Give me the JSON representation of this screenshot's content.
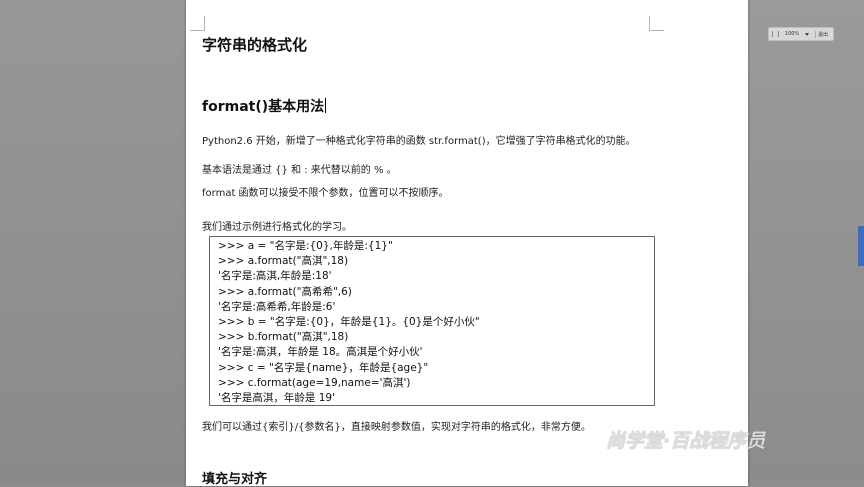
{
  "document": {
    "title": "字符串的格式化",
    "section1_heading": "format()基本用法",
    "para1": "Python2.6 开始，新增了一种格式化字符串的函数 str.format()，它增强了字符串格式化的功能。",
    "para2": "基本语法是通过 {} 和 : 来代替以前的 % 。",
    "para3": "format 函数可以接受不限个参数，位置可以不按顺序。",
    "para4": "我们通过示例进行格式化的学习。",
    "code_lines": [
      ">>> a = \"名字是:{0},年龄是:{1}\"",
      ">>> a.format(\"高淇\",18)",
      "'名字是:高淇,年龄是:18'",
      ">>> a.format(\"高希希\",6)",
      "'名字是:高希希,年龄是:6'",
      ">>> b = \"名字是:{0}，年龄是{1}。{0}是个好小伙\"",
      ">>> b.format(\"高淇\",18)",
      "'名字是:高淇，年龄是 18。高淇是个好小伙'",
      ">>> c = \"名字是{name}，年龄是{age}\"",
      ">>> c.format(age=19,name='高淇')",
      "'名字是高淇，年龄是 19'"
    ],
    "para5": "我们可以通过{索引}/{参数名}，直接映射参数值，实现对字符串的格式化，非常方便。",
    "section2_heading": "填充与对齐"
  },
  "toolbar": {
    "zoom_value": "100%",
    "exit_label": "退出"
  },
  "watermark": "尚学堂·百战程序员",
  "colors": {
    "background": "#8e8e8e",
    "page": "#ffffff",
    "edge_tab": "#3a6cc2"
  }
}
